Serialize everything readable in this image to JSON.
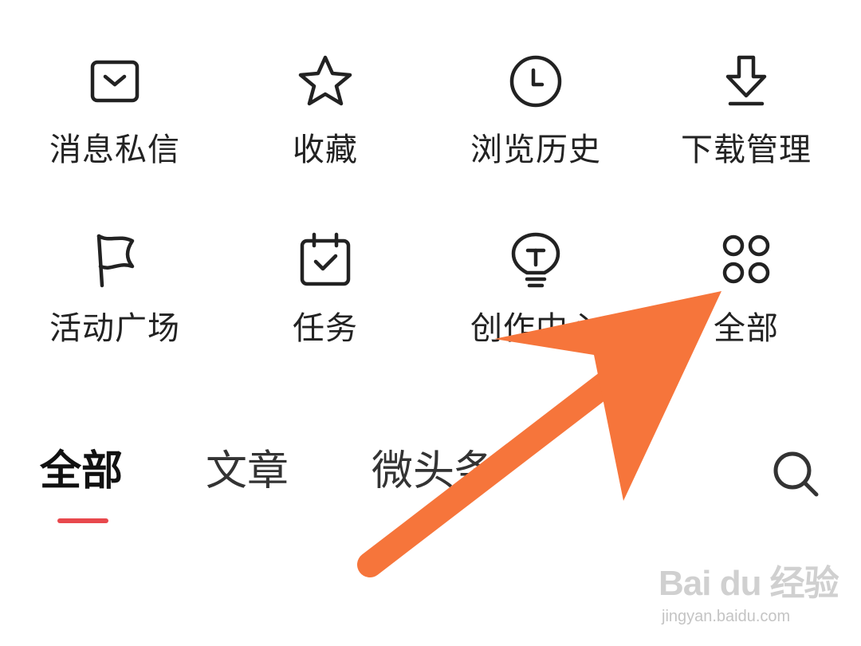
{
  "grid": {
    "row1": [
      {
        "label": "消息私信",
        "icon": "mail-icon"
      },
      {
        "label": "收藏",
        "icon": "star-icon"
      },
      {
        "label": "浏览历史",
        "icon": "clock-icon"
      },
      {
        "label": "下载管理",
        "icon": "download-icon"
      }
    ],
    "row2": [
      {
        "label": "活动广场",
        "icon": "flag-icon"
      },
      {
        "label": "任务",
        "icon": "calendar-check-icon"
      },
      {
        "label": "创作中心",
        "icon": "lightbulb-icon"
      },
      {
        "label": "全部",
        "icon": "grid-dots-icon"
      }
    ]
  },
  "tabs": {
    "items": [
      {
        "label": "全部",
        "active": true
      },
      {
        "label": "文章",
        "active": false
      },
      {
        "label": "微头条",
        "active": false
      }
    ],
    "search_icon": "search-icon"
  },
  "overlay": {
    "arrow_color": "#F6753B"
  },
  "accent": {
    "tab_underline": "#E8484D"
  },
  "watermark": {
    "brand": "Bai du 经验",
    "url": "jingyan.baidu.com"
  }
}
